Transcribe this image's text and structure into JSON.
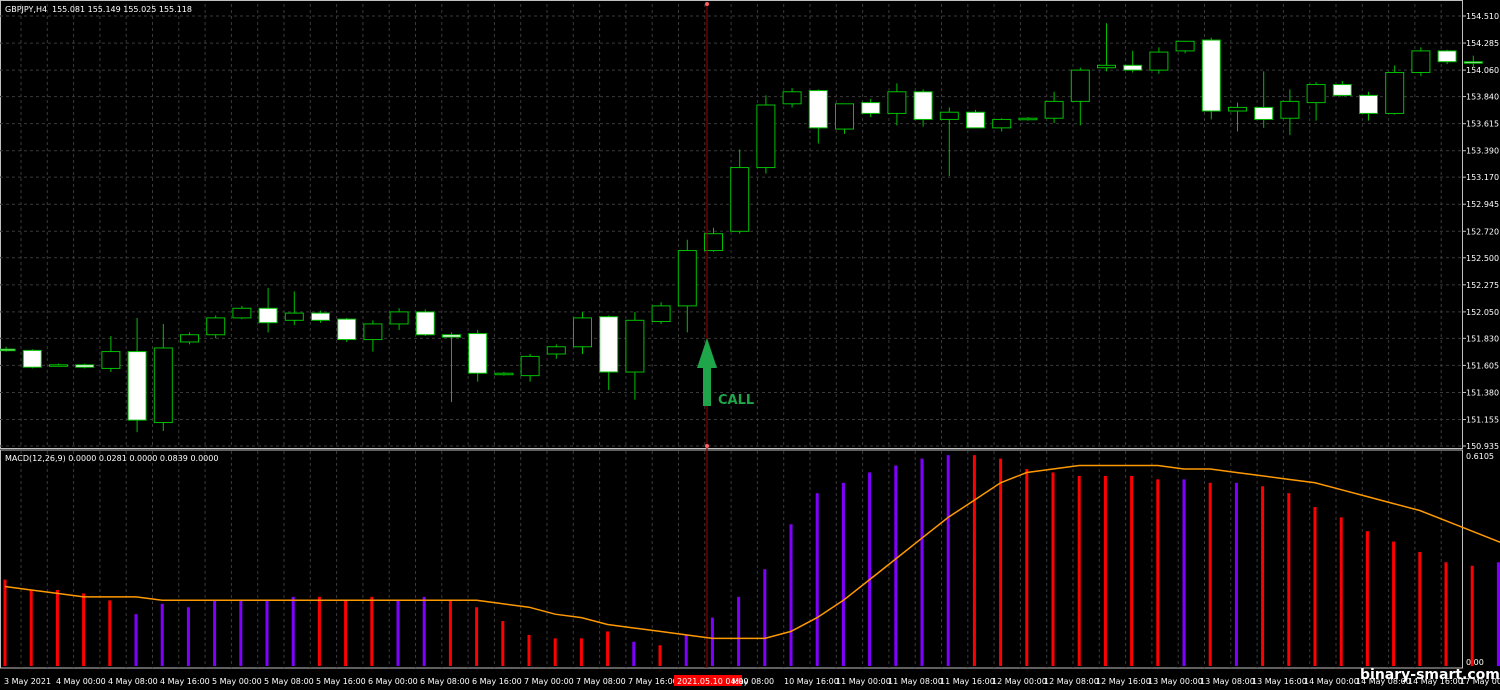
{
  "chart_header": {
    "symbol": "GBPJPY,H4",
    "ohlc": "155.081 155.149 155.025 155.118"
  },
  "indicator_header": "MACD(12,26,9) 0.0000 0.0281 0.0000 0.0839 0.0000",
  "price_axis": [
    "154.510",
    "154.285",
    "154.060",
    "153.840",
    "153.615",
    "153.390",
    "153.170",
    "152.945",
    "152.720",
    "152.500",
    "152.275",
    "152.050",
    "151.830",
    "151.605",
    "151.380",
    "151.155",
    "150.935"
  ],
  "macd_axis": [
    "0.6105",
    "0.00"
  ],
  "time_axis": [
    "3 May 2021",
    "4 May 00:00",
    "4 May 08:00",
    "4 May 16:00",
    "5 May 00:00",
    "5 May 08:00",
    "5 May 16:00",
    "6 May 00:00",
    "6 May 08:00",
    "6 May 16:00",
    "7 May 00:00",
    "7 May 08:00",
    "7 May 16:00",
    "2021.05.10 04:00",
    "May 08:00",
    "10 May 16:00",
    "11 May 00:00",
    "11 May 08:00",
    "11 May 16:00",
    "12 May 00:00",
    "12 May 08:00",
    "12 May 16:00",
    "13 May 00:00",
    "13 May 08:00",
    "13 May 16:00",
    "14 May 00:00",
    "14 May 08:00",
    "14 May 16:00",
    "17 May 00:00"
  ],
  "signal": {
    "label": "CALL",
    "color": "#1fa64a"
  },
  "watermark": "binary-smart.com",
  "colors": {
    "bg": "#000000",
    "grid": "#3a3a3a",
    "bull": "#000000",
    "bear": "#ffffff",
    "candle_outline": "#00c000",
    "macd_up": "#8000ff",
    "macd_down": "#ff0000",
    "signal_line": "#ff9900",
    "cursor": "#8b0000"
  },
  "chart_data": {
    "type": "candlestick",
    "ylim": [
      150.935,
      154.51
    ],
    "candles": [
      {
        "o": 151.74,
        "h": 151.76,
        "l": 151.72,
        "c": 151.73
      },
      {
        "o": 151.73,
        "h": 151.74,
        "l": 151.58,
        "c": 151.59
      },
      {
        "o": 151.61,
        "h": 151.62,
        "l": 151.6,
        "c": 151.61
      },
      {
        "o": 151.61,
        "h": 151.62,
        "l": 151.58,
        "c": 151.59
      },
      {
        "o": 151.58,
        "h": 151.85,
        "l": 151.55,
        "c": 151.72
      },
      {
        "o": 151.72,
        "h": 152.0,
        "l": 151.05,
        "c": 151.15
      },
      {
        "o": 151.13,
        "h": 151.95,
        "l": 151.06,
        "c": 151.75
      },
      {
        "o": 151.8,
        "h": 151.88,
        "l": 151.78,
        "c": 151.86
      },
      {
        "o": 151.86,
        "h": 152.02,
        "l": 151.83,
        "c": 152.0
      },
      {
        "o": 152.0,
        "h": 152.1,
        "l": 151.99,
        "c": 152.08
      },
      {
        "o": 152.08,
        "h": 152.25,
        "l": 151.88,
        "c": 151.96
      },
      {
        "o": 151.98,
        "h": 152.22,
        "l": 151.94,
        "c": 152.04
      },
      {
        "o": 152.04,
        "h": 152.06,
        "l": 151.96,
        "c": 151.98
      },
      {
        "o": 151.99,
        "h": 152.0,
        "l": 151.8,
        "c": 151.82
      },
      {
        "o": 151.82,
        "h": 151.98,
        "l": 151.72,
        "c": 151.95
      },
      {
        "o": 151.95,
        "h": 152.08,
        "l": 151.9,
        "c": 152.05
      },
      {
        "o": 152.05,
        "h": 152.07,
        "l": 151.85,
        "c": 151.86
      },
      {
        "o": 151.86,
        "h": 151.88,
        "l": 151.3,
        "c": 151.84
      },
      {
        "o": 151.87,
        "h": 151.9,
        "l": 151.47,
        "c": 151.54
      },
      {
        "o": 151.53,
        "h": 151.55,
        "l": 151.52,
        "c": 151.54
      },
      {
        "o": 151.52,
        "h": 151.7,
        "l": 151.47,
        "c": 151.68
      },
      {
        "o": 151.7,
        "h": 151.78,
        "l": 151.66,
        "c": 151.76
      },
      {
        "o": 151.76,
        "h": 152.05,
        "l": 151.7,
        "c": 152.0
      },
      {
        "o": 152.01,
        "h": 152.02,
        "l": 151.4,
        "c": 151.55
      },
      {
        "o": 151.55,
        "h": 152.05,
        "l": 151.32,
        "c": 151.98
      },
      {
        "o": 151.97,
        "h": 152.13,
        "l": 151.95,
        "c": 152.1
      },
      {
        "o": 152.1,
        "h": 152.65,
        "l": 151.88,
        "c": 152.56
      },
      {
        "o": 152.56,
        "h": 152.75,
        "l": 152.55,
        "c": 152.7
      },
      {
        "o": 152.72,
        "h": 153.4,
        "l": 152.7,
        "c": 153.25
      },
      {
        "o": 153.25,
        "h": 153.85,
        "l": 153.2,
        "c": 153.77
      },
      {
        "o": 153.78,
        "h": 153.91,
        "l": 153.75,
        "c": 153.88
      },
      {
        "o": 153.89,
        "h": 153.9,
        "l": 153.45,
        "c": 153.58
      },
      {
        "o": 153.57,
        "h": 153.78,
        "l": 153.53,
        "c": 153.78
      },
      {
        "o": 153.79,
        "h": 153.82,
        "l": 153.67,
        "c": 153.7
      },
      {
        "o": 153.7,
        "h": 153.95,
        "l": 153.6,
        "c": 153.88
      },
      {
        "o": 153.88,
        "h": 153.9,
        "l": 153.59,
        "c": 153.65
      },
      {
        "o": 153.65,
        "h": 153.75,
        "l": 153.18,
        "c": 153.71
      },
      {
        "o": 153.71,
        "h": 153.73,
        "l": 153.58,
        "c": 153.58
      },
      {
        "o": 153.58,
        "h": 153.66,
        "l": 153.55,
        "c": 153.65
      },
      {
        "o": 153.65,
        "h": 153.67,
        "l": 153.64,
        "c": 153.66
      },
      {
        "o": 153.66,
        "h": 153.88,
        "l": 153.62,
        "c": 153.8
      },
      {
        "o": 153.8,
        "h": 154.08,
        "l": 153.6,
        "c": 154.06
      },
      {
        "o": 154.08,
        "h": 154.45,
        "l": 154.05,
        "c": 154.1
      },
      {
        "o": 154.1,
        "h": 154.22,
        "l": 154.04,
        "c": 154.06
      },
      {
        "o": 154.06,
        "h": 154.25,
        "l": 154.03,
        "c": 154.21
      },
      {
        "o": 154.22,
        "h": 154.3,
        "l": 154.2,
        "c": 154.3
      },
      {
        "o": 154.31,
        "h": 154.33,
        "l": 153.65,
        "c": 153.72
      },
      {
        "o": 153.72,
        "h": 153.79,
        "l": 153.55,
        "c": 153.75
      },
      {
        "o": 153.75,
        "h": 154.05,
        "l": 153.58,
        "c": 153.65
      },
      {
        "o": 153.66,
        "h": 153.9,
        "l": 153.52,
        "c": 153.8
      },
      {
        "o": 153.79,
        "h": 153.96,
        "l": 153.64,
        "c": 153.94
      },
      {
        "o": 153.94,
        "h": 153.97,
        "l": 153.84,
        "c": 153.85
      },
      {
        "o": 153.85,
        "h": 153.88,
        "l": 153.64,
        "c": 153.7
      },
      {
        "o": 153.7,
        "h": 154.1,
        "l": 153.69,
        "c": 154.04
      },
      {
        "o": 154.04,
        "h": 154.25,
        "l": 154.01,
        "c": 154.22
      },
      {
        "o": 154.22,
        "h": 154.23,
        "l": 154.11,
        "c": 154.13
      },
      {
        "o": 154.13,
        "h": 154.18,
        "l": 154.08,
        "c": 154.12
      }
    ],
    "macd": {
      "ylim": [
        0,
        0.6105
      ],
      "histogram": [
        0.25,
        0.22,
        0.22,
        0.21,
        0.19,
        0.15,
        0.18,
        0.17,
        0.19,
        0.19,
        0.19,
        0.2,
        0.2,
        0.19,
        0.2,
        0.19,
        0.2,
        0.19,
        0.17,
        0.13,
        0.09,
        0.08,
        0.08,
        0.1,
        0.07,
        0.06,
        0.09,
        0.14,
        0.2,
        0.28,
        0.41,
        0.5,
        0.53,
        0.56,
        0.58,
        0.6,
        0.61,
        0.61,
        0.6,
        0.57,
        0.56,
        0.55,
        0.55,
        0.55,
        0.54,
        0.54,
        0.53,
        0.53,
        0.52,
        0.5,
        0.46,
        0.43,
        0.39,
        0.36,
        0.33,
        0.3,
        0.29,
        0.3,
        0.29,
        0.29
      ],
      "histogram_color": [
        "d",
        "d",
        "d",
        "d",
        "d",
        "u",
        "u",
        "u",
        "u",
        "u",
        "u",
        "u",
        "d",
        "d",
        "d",
        "u",
        "u",
        "d",
        "d",
        "d",
        "d",
        "d",
        "d",
        "d",
        "u",
        "d",
        "u",
        "u",
        "u",
        "u",
        "u",
        "u",
        "u",
        "u",
        "u",
        "u",
        "u",
        "d",
        "d",
        "d",
        "d",
        "d",
        "d",
        "d",
        "d",
        "u",
        "d",
        "u",
        "d",
        "d",
        "d",
        "d",
        "d",
        "d",
        "d",
        "d",
        "d",
        "u",
        "d",
        "d"
      ],
      "signal": [
        0.23,
        0.22,
        0.21,
        0.2,
        0.2,
        0.2,
        0.19,
        0.19,
        0.19,
        0.19,
        0.19,
        0.19,
        0.19,
        0.19,
        0.19,
        0.19,
        0.19,
        0.19,
        0.19,
        0.18,
        0.17,
        0.15,
        0.14,
        0.12,
        0.11,
        0.1,
        0.09,
        0.08,
        0.08,
        0.08,
        0.1,
        0.14,
        0.19,
        0.25,
        0.31,
        0.37,
        0.43,
        0.48,
        0.53,
        0.56,
        0.57,
        0.58,
        0.58,
        0.58,
        0.58,
        0.57,
        0.57,
        0.56,
        0.55,
        0.54,
        0.53,
        0.51,
        0.49,
        0.47,
        0.45,
        0.42,
        0.39,
        0.36,
        0.33,
        0.3
      ]
    },
    "signal_candle_index": 27
  }
}
